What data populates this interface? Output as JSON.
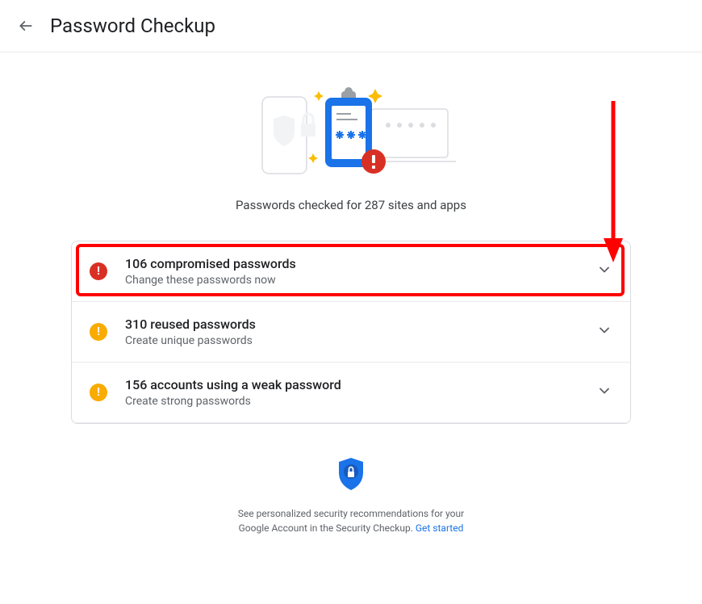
{
  "header": {
    "title": "Password Checkup"
  },
  "summary": "Passwords checked for 287 sites and apps",
  "rows": [
    {
      "icon_color": "red",
      "title": "106 compromised passwords",
      "subtitle": "Change these passwords now"
    },
    {
      "icon_color": "yellow",
      "title": "310 reused passwords",
      "subtitle": "Create unique passwords"
    },
    {
      "icon_color": "yellow",
      "title": "156 accounts using a weak password",
      "subtitle": "Create strong passwords"
    }
  ],
  "footer": {
    "text_part1": "See personalized security recommendations for your Google Account in the Security Checkup. ",
    "link": "Get started"
  }
}
